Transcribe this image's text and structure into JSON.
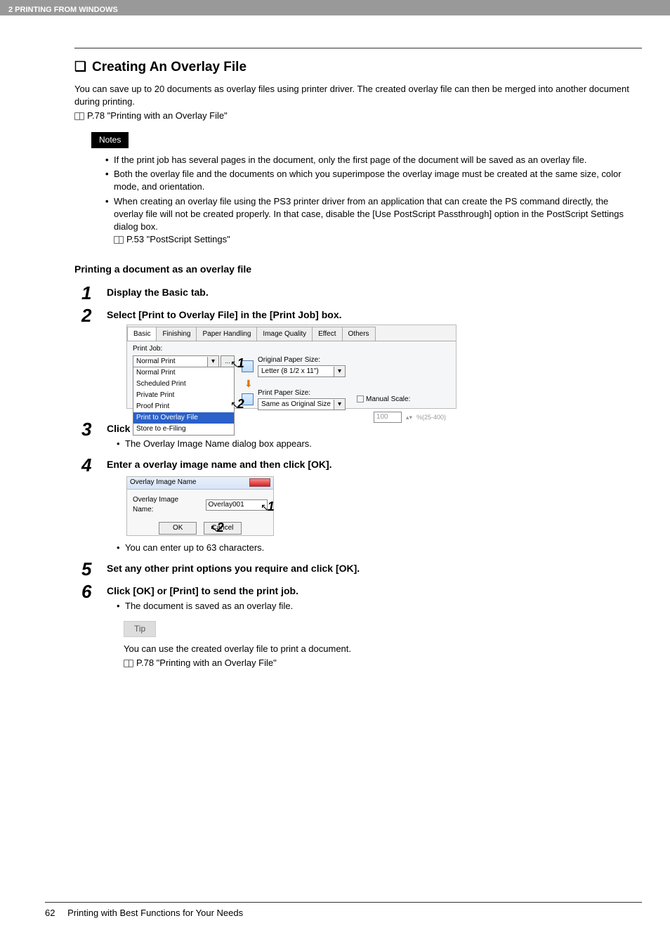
{
  "header": {
    "chapter": "2 PRINTING FROM WINDOWS"
  },
  "h2": {
    "title": "Creating An Overlay File"
  },
  "intro": "You can save up to 20 documents as overlay files using printer driver.  The created overlay file can then be merged into another document during printing.",
  "ref1": "P.78 \"Printing with an Overlay File\"",
  "notes_label": "Notes",
  "notes": {
    "n1": "If the print job has several pages in the document, only the first page of the document will be saved as an overlay file.",
    "n2": "Both the overlay file and the documents on which you superimpose the overlay image must be created at the same size, color mode, and orientation.",
    "n3": "When creating an overlay file using the PS3 printer driver from an application that can create the PS command directly, the overlay file will not be created properly.  In that case, disable the [Use PostScript Passthrough] option in the PostScript Settings dialog box.",
    "n3ref": "P.53 \"PostScript Settings\""
  },
  "h3": "Printing a document as an overlay file",
  "steps": {
    "s1": {
      "num": "1",
      "title": "Display the Basic tab."
    },
    "s2": {
      "num": "2",
      "title": "Select [Print to Overlay File] in the [Print Job] box."
    },
    "s3": {
      "num": "3",
      "title": "Click [...].",
      "bullet": "The Overlay Image Name dialog box appears."
    },
    "s4": {
      "num": "4",
      "title": "Enter a overlay image name and then click [OK].",
      "bullet": "You can enter up to 63 characters."
    },
    "s5": {
      "num": "5",
      "title": "Set any other print options you require and click [OK]."
    },
    "s6": {
      "num": "6",
      "title": "Click [OK] or [Print] to send the print job.",
      "bullet": "The document is saved as an overlay file."
    }
  },
  "shot1": {
    "tabs": {
      "basic": "Basic",
      "finishing": "Finishing",
      "paper": "Paper Handling",
      "image": "Image Quality",
      "effect": "Effect",
      "others": "Others"
    },
    "print_job_label": "Print Job:",
    "combo_value": "Normal Print",
    "dotbtn": "...",
    "dropdown": {
      "o1": "Normal Print",
      "o2": "Scheduled Print",
      "o3": "Private Print",
      "o4": "Proof Print",
      "o5": "Print to Overlay File",
      "o6": "Store to e-Filing"
    },
    "ops_label": "Original Paper Size:",
    "ops_value": "Letter (8 1/2 x 11\")",
    "pps_label": "Print Paper Size:",
    "pps_value": "Same as Original Size",
    "ms_label": "Manual Scale:",
    "ms_value": "100",
    "ms_range": "%(25-400)",
    "cnum1": "1",
    "cnum2": "2"
  },
  "shot2": {
    "title": "Overlay Image Name",
    "label": "Overlay Image Name:",
    "value": "Overlay001",
    "ok": "OK",
    "cancel": "Cancel",
    "cnum1": "1",
    "cnum2": "2"
  },
  "tip_label": "Tip",
  "tip_text": "You can use the created overlay file to print a document.",
  "tip_ref": "P.78 \"Printing with an Overlay File\"",
  "footer": {
    "page": "62",
    "section": "Printing with Best Functions for Your Needs"
  }
}
